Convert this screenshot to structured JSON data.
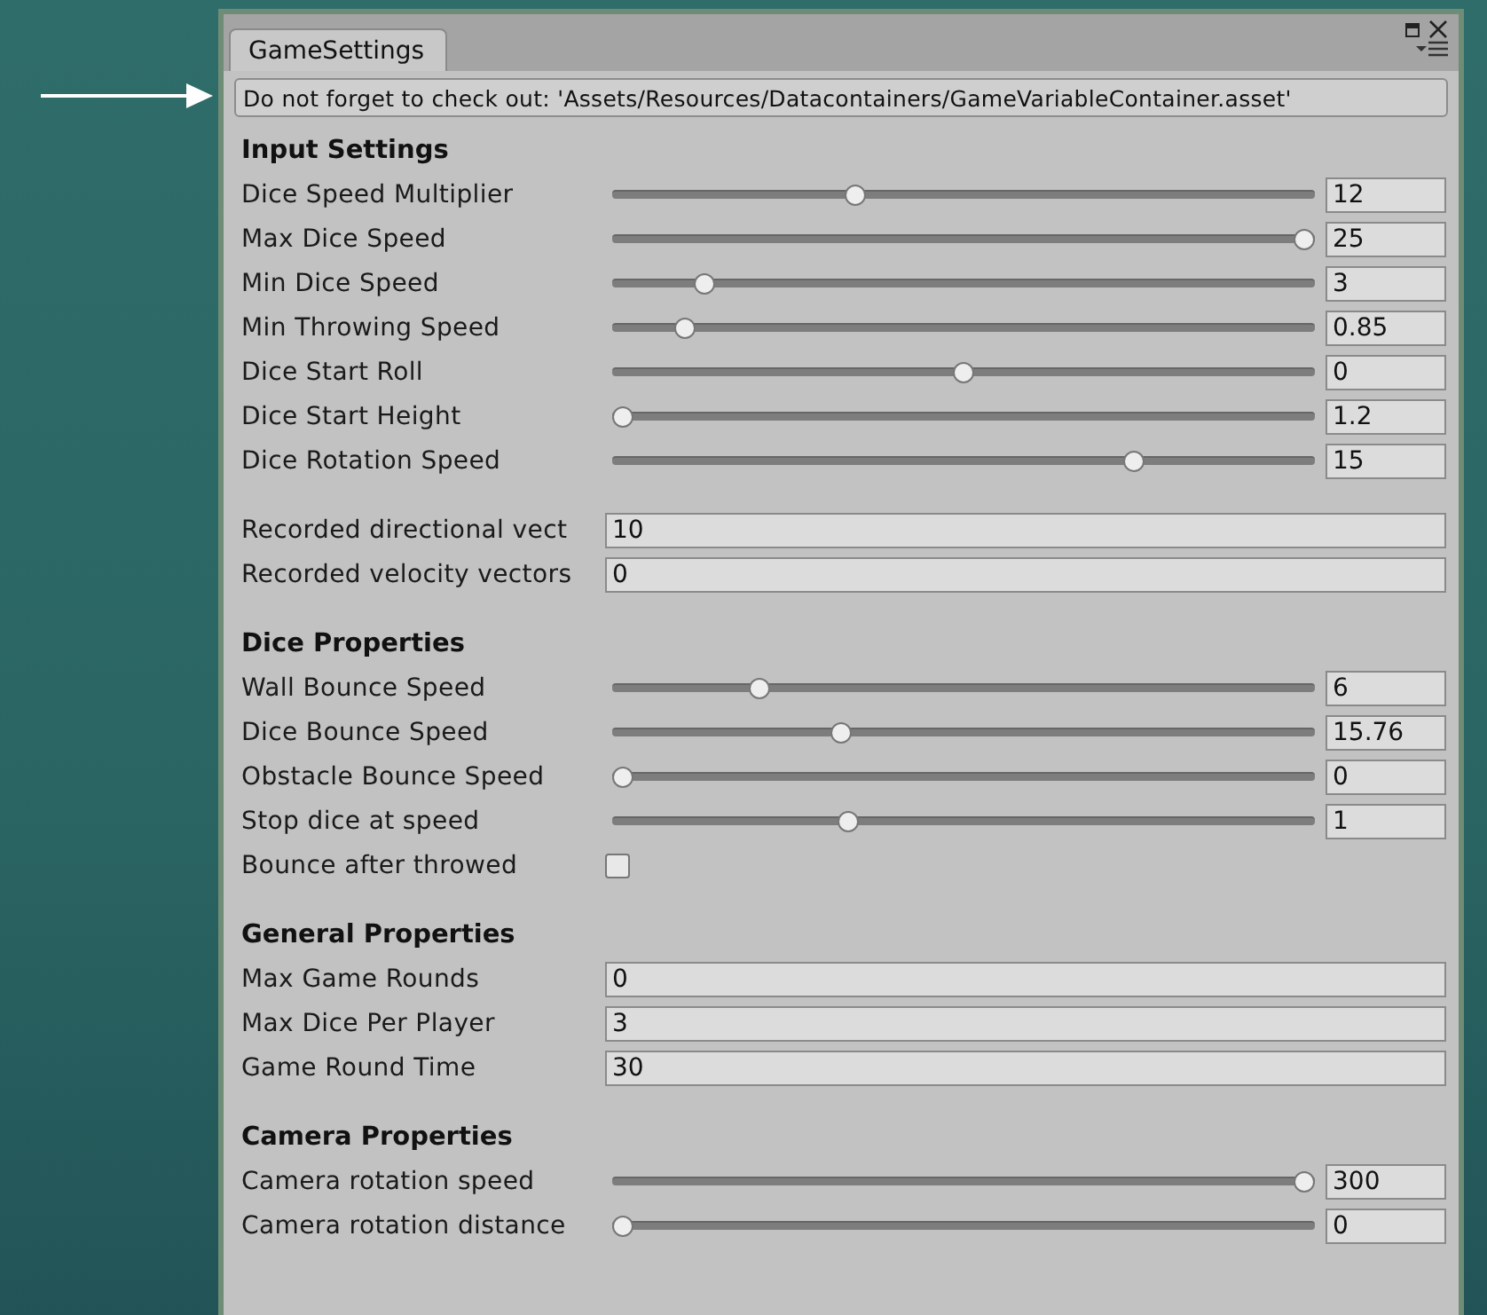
{
  "window": {
    "tab": "GameSettings",
    "selected": true
  },
  "notice": "Do not forget to check out: 'Assets/Resources/Datacontainers/GameVariableContainer.asset'",
  "sections": [
    {
      "title": "Input Settings",
      "groups": [
        [
          {
            "kind": "slider",
            "label": "Dice Speed Multiplier",
            "level": 0.34,
            "value": "12"
          },
          {
            "kind": "slider",
            "label": "Max Dice Speed",
            "level": 1.0,
            "value": "25"
          },
          {
            "kind": "slider",
            "label": "Min Dice Speed",
            "level": 0.12,
            "value": "3"
          },
          {
            "kind": "slider",
            "label": "Min Throwing Speed",
            "level": 0.09,
            "value": "0.85"
          },
          {
            "kind": "slider",
            "label": "Dice Start Roll",
            "level": 0.5,
            "value": "0"
          },
          {
            "kind": "slider",
            "label": "Dice Start Height",
            "level": 0.0,
            "value": "1.2"
          },
          {
            "kind": "slider",
            "label": "Dice Rotation Speed",
            "level": 0.75,
            "value": "15"
          }
        ],
        [
          {
            "kind": "field",
            "label": "Recorded directional vect",
            "value": "10"
          },
          {
            "kind": "field",
            "label": "Recorded velocity vectors",
            "value": "0"
          }
        ]
      ]
    },
    {
      "title": "Dice Properties",
      "groups": [
        [
          {
            "kind": "slider",
            "label": "Wall Bounce Speed",
            "level": 0.2,
            "value": "6"
          },
          {
            "kind": "slider",
            "label": "Dice Bounce Speed",
            "level": 0.32,
            "value": "15.76"
          },
          {
            "kind": "slider",
            "label": "Obstacle Bounce Speed",
            "level": 0.0,
            "value": "0"
          },
          {
            "kind": "slider",
            "label": "Stop dice at speed",
            "level": 0.33,
            "value": "1"
          },
          {
            "kind": "checkbox",
            "label": "Bounce after throwed",
            "checked": false
          }
        ]
      ]
    },
    {
      "title": "General Properties",
      "groups": [
        [
          {
            "kind": "field",
            "label": "Max Game Rounds",
            "value": "0"
          },
          {
            "kind": "field",
            "label": "Max Dice Per Player",
            "value": "3"
          },
          {
            "kind": "field",
            "label": "Game Round Time",
            "value": "30"
          }
        ]
      ]
    },
    {
      "title": "Camera Properties",
      "groups": [
        [
          {
            "kind": "slider",
            "label": "Camera rotation speed",
            "level": 1.0,
            "value": "300"
          },
          {
            "kind": "slider",
            "label": "Camera rotation distance",
            "level": 0.0,
            "value": "0"
          }
        ]
      ]
    }
  ]
}
